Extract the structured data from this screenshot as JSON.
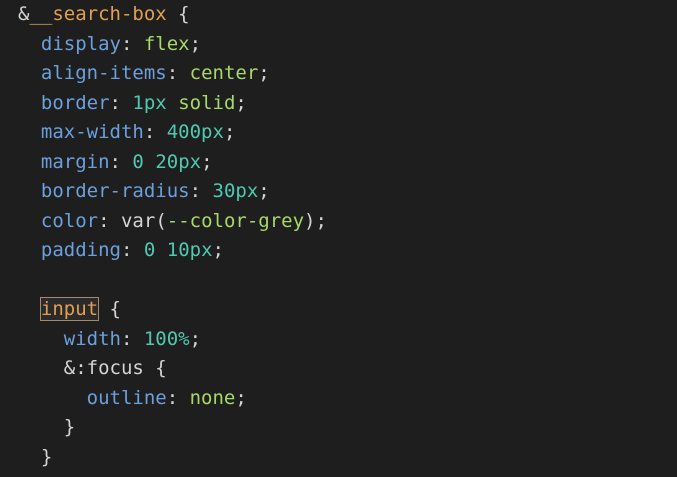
{
  "editor": {
    "lines": [
      {
        "indent": "",
        "parts": [
          {
            "t": "&",
            "c": "amp"
          },
          {
            "t": "__search-box",
            "c": "sel"
          },
          {
            "t": " {",
            "c": "punc"
          }
        ]
      },
      {
        "indent": "  ",
        "parts": [
          {
            "t": "display",
            "c": "prop"
          },
          {
            "t": ": ",
            "c": "punc"
          },
          {
            "t": "flex",
            "c": "kw"
          },
          {
            "t": ";",
            "c": "punc"
          }
        ]
      },
      {
        "indent": "  ",
        "parts": [
          {
            "t": "align-items",
            "c": "prop"
          },
          {
            "t": ": ",
            "c": "punc"
          },
          {
            "t": "center",
            "c": "kw"
          },
          {
            "t": ";",
            "c": "punc"
          }
        ]
      },
      {
        "indent": "  ",
        "parts": [
          {
            "t": "border",
            "c": "prop"
          },
          {
            "t": ": ",
            "c": "punc"
          },
          {
            "t": "1px",
            "c": "num"
          },
          {
            "t": " ",
            "c": "punc"
          },
          {
            "t": "solid",
            "c": "kw"
          },
          {
            "t": ";",
            "c": "punc"
          }
        ]
      },
      {
        "indent": "  ",
        "parts": [
          {
            "t": "max-width",
            "c": "prop"
          },
          {
            "t": ": ",
            "c": "punc"
          },
          {
            "t": "400px",
            "c": "num"
          },
          {
            "t": ";",
            "c": "punc"
          }
        ]
      },
      {
        "indent": "  ",
        "parts": [
          {
            "t": "margin",
            "c": "prop"
          },
          {
            "t": ": ",
            "c": "punc"
          },
          {
            "t": "0",
            "c": "num"
          },
          {
            "t": " ",
            "c": "punc"
          },
          {
            "t": "20px",
            "c": "num"
          },
          {
            "t": ";",
            "c": "punc"
          }
        ]
      },
      {
        "indent": "  ",
        "parts": [
          {
            "t": "border-radius",
            "c": "prop"
          },
          {
            "t": ": ",
            "c": "punc"
          },
          {
            "t": "30px",
            "c": "num"
          },
          {
            "t": ";",
            "c": "punc"
          }
        ]
      },
      {
        "indent": "  ",
        "parts": [
          {
            "t": "color",
            "c": "prop"
          },
          {
            "t": ": ",
            "c": "punc"
          },
          {
            "t": "var",
            "c": "fn"
          },
          {
            "t": "(",
            "c": "punc"
          },
          {
            "t": "--color-grey",
            "c": "var"
          },
          {
            "t": ");",
            "c": "punc"
          }
        ]
      },
      {
        "indent": "  ",
        "parts": [
          {
            "t": "padding",
            "c": "prop"
          },
          {
            "t": ": ",
            "c": "punc"
          },
          {
            "t": "0",
            "c": "num"
          },
          {
            "t": " ",
            "c": "punc"
          },
          {
            "t": "10px",
            "c": "num"
          },
          {
            "t": ";",
            "c": "punc"
          }
        ]
      },
      {
        "indent": "",
        "parts": []
      },
      {
        "indent": "  ",
        "parts": [
          {
            "t": "input",
            "c": "tag"
          },
          {
            "t": " {",
            "c": "punc"
          }
        ]
      },
      {
        "indent": "    ",
        "parts": [
          {
            "t": "width",
            "c": "prop"
          },
          {
            "t": ": ",
            "c": "punc"
          },
          {
            "t": "100%",
            "c": "num"
          },
          {
            "t": ";",
            "c": "punc"
          }
        ]
      },
      {
        "indent": "    ",
        "parts": [
          {
            "t": "&",
            "c": "amp"
          },
          {
            "t": ":focus",
            "c": "pseudo"
          },
          {
            "t": " {",
            "c": "punc"
          }
        ]
      },
      {
        "indent": "      ",
        "parts": [
          {
            "t": "outline",
            "c": "prop"
          },
          {
            "t": ": ",
            "c": "punc"
          },
          {
            "t": "none",
            "c": "kw"
          },
          {
            "t": ";",
            "c": "punc"
          }
        ]
      },
      {
        "indent": "    ",
        "parts": [
          {
            "t": "}",
            "c": "punc"
          }
        ]
      },
      {
        "indent": "  ",
        "parts": [
          {
            "t": "}",
            "c": "punc"
          }
        ]
      }
    ]
  }
}
